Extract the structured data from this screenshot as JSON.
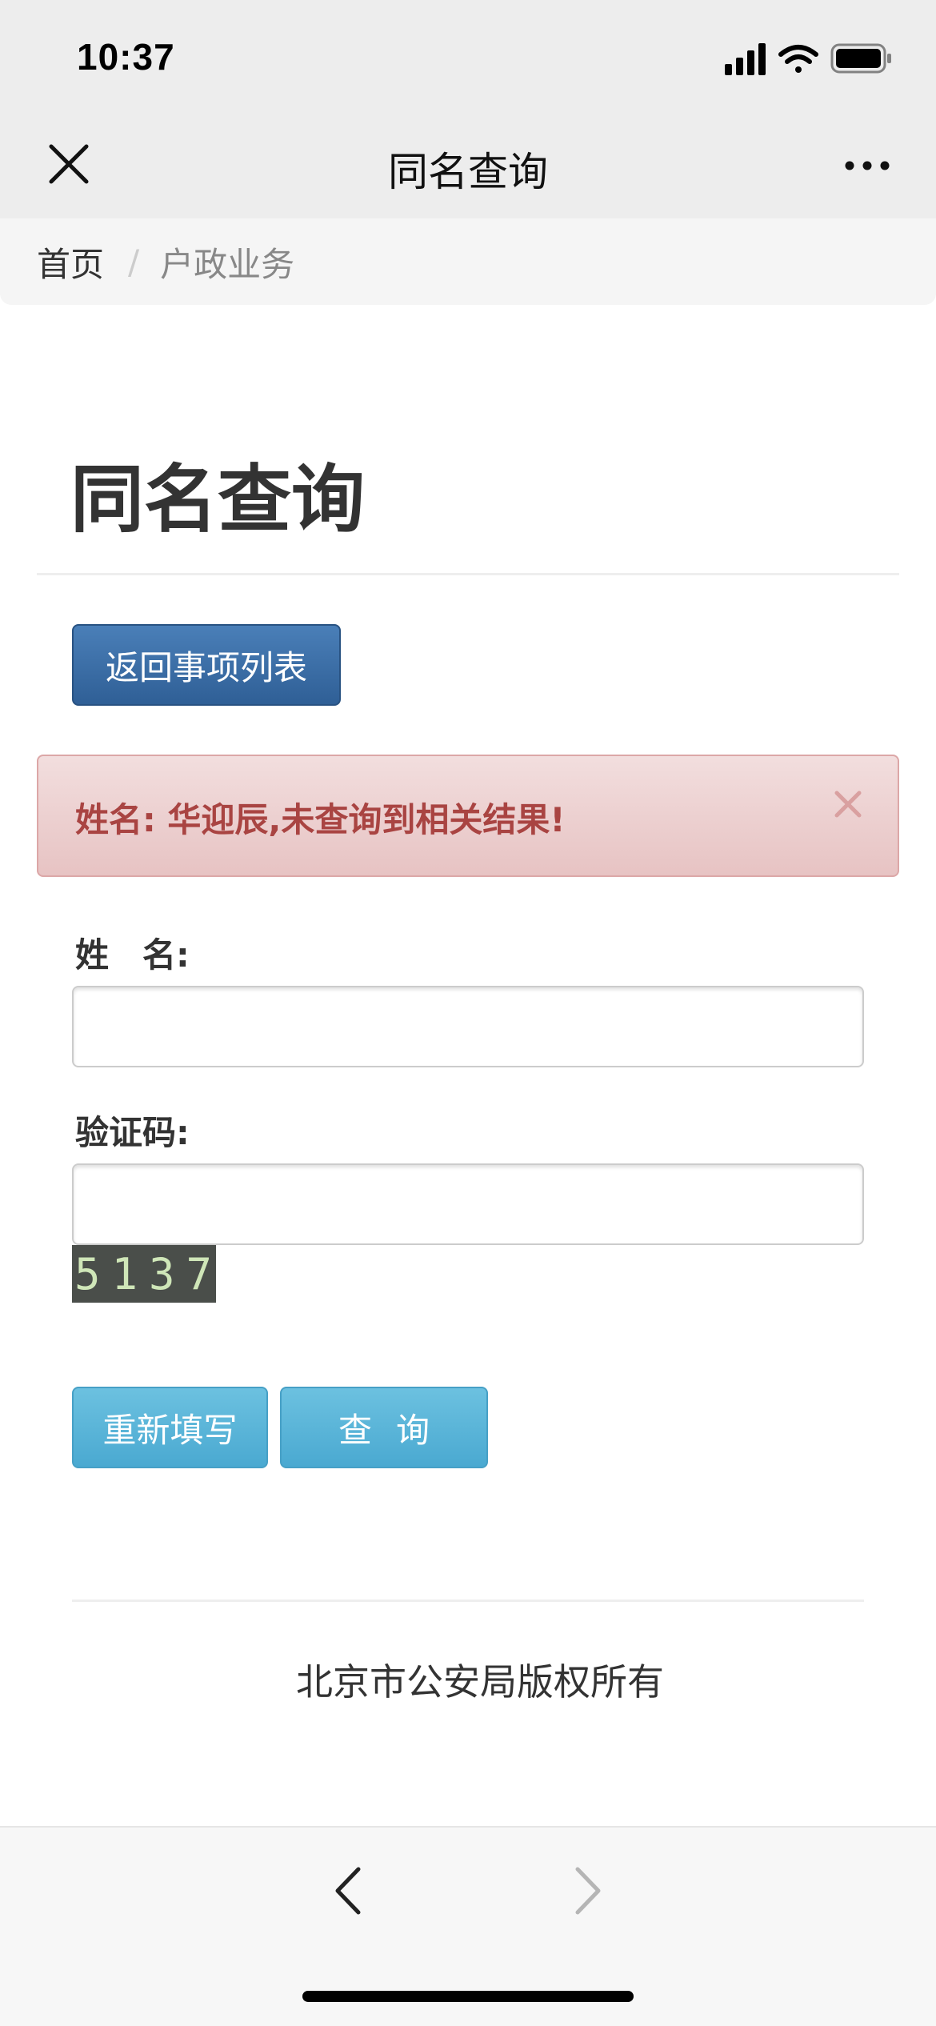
{
  "status_bar": {
    "time": "10:37",
    "icons": [
      "signal-icon",
      "wifi-icon",
      "battery-icon"
    ]
  },
  "nav": {
    "title": "同名查询",
    "close_icon": "close-icon",
    "more_icon": "more-icon"
  },
  "breadcrumb": {
    "home": "首页",
    "separator": "/",
    "current": "户政业务"
  },
  "page": {
    "title": "同名查询",
    "back_button": "返回事项列表"
  },
  "alert": {
    "message": "姓名: 华迎辰,未查询到相关结果!",
    "close_glyph": "×"
  },
  "form": {
    "name_label": "姓　名:",
    "name_value": "",
    "captcha_label": "验证码:",
    "captcha_value": "",
    "captcha_code": "5137",
    "reset_button": "重新填写",
    "query_button": "查询"
  },
  "footer": {
    "copyright": "北京市公安局版权所有"
  },
  "toolbar": {
    "back_icon": "chevron-left-icon",
    "forward_icon": "chevron-right-icon"
  },
  "colors": {
    "primary_button": "#337ab7",
    "info_button": "#5bc0de",
    "alert_text": "#a94442",
    "alert_bg": "#f2dede"
  }
}
